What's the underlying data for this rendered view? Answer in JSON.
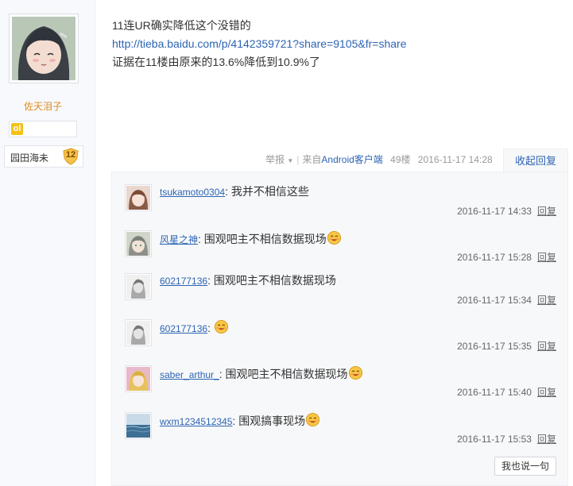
{
  "author": {
    "name": "佐天泪子",
    "level_name": "园田海未",
    "level_number": "12",
    "medal_glyph": "ol"
  },
  "post": {
    "line1": "11连UR确实降低这个没错的",
    "link": "http://tieba.baidu.com/p/4142359721?share=9105&fr=share",
    "line3": "证据在11楼由原来的13.6%降低到10.9%了"
  },
  "tail": {
    "report": "举报",
    "report_arrow": "▼",
    "separator": "|",
    "source_prefix": "来自",
    "source": "Android客户端",
    "floor": "49楼",
    "time": "2016-11-17 14:28",
    "collapse": "收起回复"
  },
  "comments": [
    {
      "user": "tsukamoto0304",
      "text": "我并不相信这些",
      "emoji": false,
      "time": "2016-11-17 14:33",
      "reply": "回复",
      "avatar": "avatar-girl-brown"
    },
    {
      "user": "风星之神",
      "text": "围观吧主不相信数据现场",
      "emoji": true,
      "time": "2016-11-17 15:28",
      "reply": "回复",
      "avatar": "avatar-girl-grey"
    },
    {
      "user": "602177136",
      "text": "围观吧主不相信数据现场",
      "emoji": false,
      "time": "2016-11-17 15:34",
      "reply": "回复",
      "avatar": "avatar-sketch"
    },
    {
      "user": "602177136",
      "text": "",
      "emoji": true,
      "time": "2016-11-17 15:35",
      "reply": "回复",
      "avatar": "avatar-sketch"
    },
    {
      "user": "saber_arthur_",
      "text": "围观吧主不相信数据现场",
      "emoji": true,
      "time": "2016-11-17 15:40",
      "reply": "回复",
      "avatar": "avatar-girl-blonde"
    },
    {
      "user": "wxm1234512345",
      "text": "围观搞事现场",
      "emoji": true,
      "time": "2016-11-17 15:53",
      "reply": "回复",
      "avatar": "avatar-sea"
    }
  ],
  "say_button": "我也说一句",
  "colon": ": ",
  "colors": {
    "link": "#2d64b3",
    "username": "#e08a1e",
    "panel": "#f7f8fa"
  }
}
